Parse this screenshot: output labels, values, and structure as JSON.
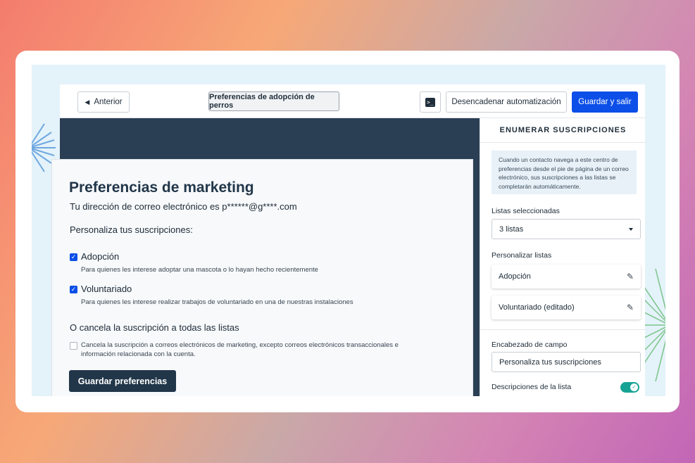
{
  "topbar": {
    "back_label": "Anterior",
    "page_name": "Preferencias de adopción de perros",
    "trigger_label": "Desencadenar automatización",
    "save_exit_label": "Guardar y salir"
  },
  "form": {
    "title": "Preferencias de marketing",
    "email_line": "Tu dirección de correo electrónico es p******@g****.com",
    "customize_label": "Personaliza tus suscripciones:",
    "options": [
      {
        "label": "Adopción",
        "description": "Para quienes les interese adoptar una mascota o lo hayan hecho recientemente",
        "checked": true
      },
      {
        "label": "Voluntariado",
        "description": "Para quienes les interese realizar trabajos de voluntariado en una de nuestras instalaciones",
        "checked": true
      }
    ],
    "unsubscribe_title": "O cancela la suscripción a todas las listas",
    "unsubscribe_text": "Cancela la suscripción a correos electrónicos de marketing, excepto correos electrónicos transaccionales e información relacionada con la cuenta.",
    "unsubscribe_checked": false,
    "save_label": "Guardar preferencias"
  },
  "panel": {
    "heading": "ENUMERAR SUSCRIPCIONES",
    "info": "Cuando un contacto navega a este centro de preferencias desde el pie de página de un correo electrónico, sus suscripciones a las listas se completarán automáticamente.",
    "selected_lists_label": "Listas seleccionadas",
    "selected_lists_value": "3 listas",
    "customize_lists_label": "Personalizar listas",
    "lists": [
      "Adopción",
      "Voluntariado (editado)"
    ],
    "field_header_label": "Encabezado de campo",
    "field_header_value": "Personaliza tus suscripciones",
    "list_descriptions_label": "Descripciones de la lista",
    "list_descriptions_enabled": true
  },
  "colors": {
    "primary": "#0c4fe8",
    "dark": "#213649",
    "toggle_on": "#16a394"
  }
}
